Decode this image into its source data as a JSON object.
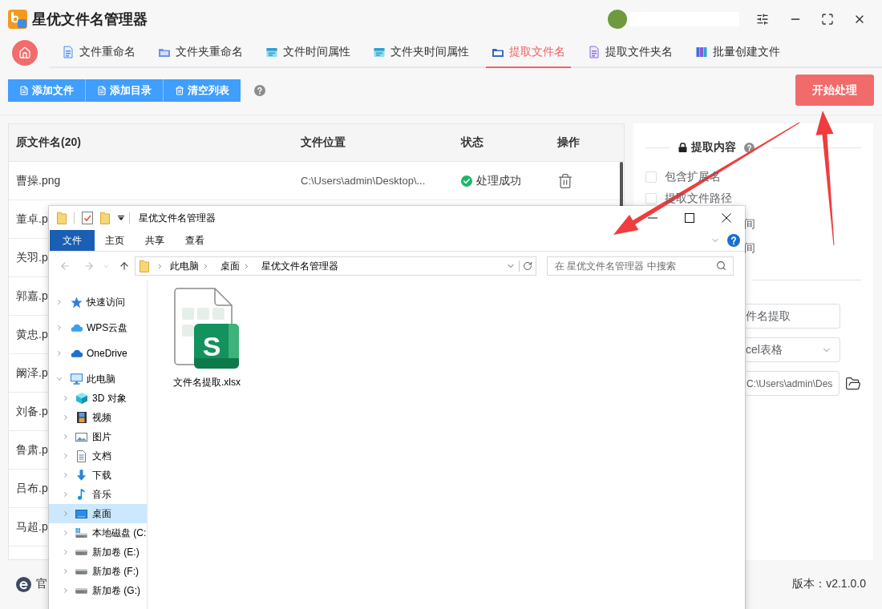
{
  "app": {
    "title": "星优文件名管理器"
  },
  "nav_tabs": [
    {
      "label": "文件重命名",
      "selected": false
    },
    {
      "label": "文件夹重命名",
      "selected": false
    },
    {
      "label": "文件时间属性",
      "selected": false
    },
    {
      "label": "文件夹时间属性",
      "selected": false
    },
    {
      "label": "提取文件名",
      "selected": true
    },
    {
      "label": "提取文件夹名",
      "selected": false
    },
    {
      "label": "批量创建文件",
      "selected": false
    }
  ],
  "toolbar": {
    "buttons": [
      "添加文件",
      "添加目录",
      "清空列表"
    ],
    "start_button": "开始处理"
  },
  "table": {
    "columns": [
      "原文件名(20)",
      "文件位置",
      "状态",
      "操作"
    ],
    "rows": [
      {
        "kind": "full",
        "name": "曹操.png",
        "location": "C:\\Users\\admin\\Desktop\\...",
        "status": "处理成功"
      },
      {
        "kind": "covered",
        "name": "董卓.p"
      },
      {
        "kind": "covered",
        "name": "关羽.p"
      },
      {
        "kind": "covered",
        "name": "郭嘉.p"
      },
      {
        "kind": "covered",
        "name": "黄忠.p"
      },
      {
        "kind": "covered",
        "name": "阚泽.p"
      },
      {
        "kind": "covered",
        "name": "刘备.p"
      },
      {
        "kind": "covered",
        "name": "鲁肃.p"
      },
      {
        "kind": "covered",
        "name": "吕布.p"
      },
      {
        "kind": "covered",
        "name": "马超.p"
      }
    ]
  },
  "extract_panel": {
    "title": "提取内容",
    "options": [
      {
        "label": "包含扩展名",
        "checked": false
      },
      {
        "label": "提取文件路径",
        "checked": false
      }
    ],
    "covered_texts": [
      "间",
      "间"
    ],
    "name_field": {
      "value": "件名提取"
    },
    "format_select": {
      "value": "cel表格"
    },
    "path_field": {
      "value": "C:\\Users\\admin\\Des"
    }
  },
  "footer": {
    "link": "官",
    "version": "版本：v2.1.0.0"
  },
  "explorer": {
    "title": "星优文件名管理器",
    "ribbon": [
      {
        "label": "文件",
        "kind": "menu"
      },
      {
        "label": "主页",
        "kind": "tab"
      },
      {
        "label": "共享",
        "kind": "tab"
      },
      {
        "label": "查看",
        "kind": "tab"
      }
    ],
    "address": [
      "此电脑",
      "桌面",
      "星优文件名管理器"
    ],
    "search": {
      "placeholder": "在 星优文件名管理器 中搜索"
    },
    "nav_pane": [
      {
        "label": "快速访问",
        "expanded": false,
        "selected": false
      },
      {
        "label": "WPS云盘",
        "expanded": false,
        "selected": false
      },
      {
        "label": "OneDrive",
        "expanded": false,
        "selected": false
      },
      {
        "label": "此电脑",
        "expanded": true,
        "selected": false,
        "children": [
          {
            "label": "3D 对象",
            "expanded": false,
            "selected": false
          },
          {
            "label": "视频",
            "expanded": false,
            "selected": false
          },
          {
            "label": "图片",
            "expanded": false,
            "selected": false
          },
          {
            "label": "文档",
            "expanded": false,
            "selected": false
          },
          {
            "label": "下载",
            "expanded": false,
            "selected": false
          },
          {
            "label": "音乐",
            "expanded": false,
            "selected": false
          },
          {
            "label": "桌面",
            "expanded": false,
            "selected": true
          },
          {
            "label": "本地磁盘 (C:",
            "expanded": false,
            "selected": false
          },
          {
            "label": "新加卷 (E:)",
            "expanded": false,
            "selected": false
          },
          {
            "label": "新加卷 (F:)",
            "expanded": false,
            "selected": false
          },
          {
            "label": "新加卷 (G:)",
            "expanded": false,
            "selected": false
          }
        ]
      }
    ],
    "files": [
      {
        "name": "文件名提取.xlsx",
        "icon_letter": "S"
      }
    ]
  }
}
